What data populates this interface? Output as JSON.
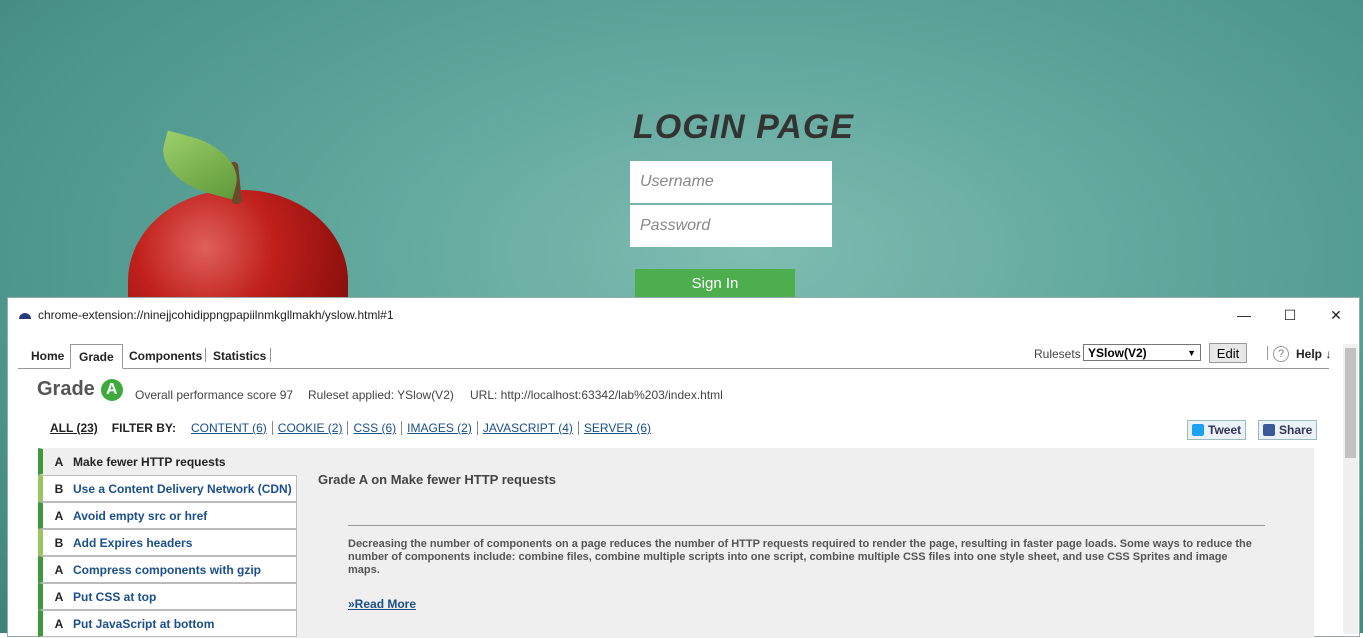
{
  "login": {
    "title": "LOGIN PAGE",
    "username_placeholder": "Username",
    "password_placeholder": "Password",
    "signin_label": "Sign In"
  },
  "popup": {
    "url": "chrome-extension://ninejjcohidippngpapiilnmkgllmakh/yslow.html#1",
    "tabs": [
      "Home",
      "Grade",
      "Components",
      "Statistics"
    ],
    "active_tab": "Grade",
    "rulesets_label": "Rulesets",
    "ruleset_value": "YSlow(V2)",
    "edit_label": "Edit",
    "help_icon_text": "?",
    "help_label": "Help ↓"
  },
  "grade": {
    "label": "Grade",
    "letter": "A",
    "score_text": "Overall performance score 97",
    "ruleset_text": "Ruleset applied: YSlow(V2)",
    "url_text": "URL: http://localhost:63342/lab%203/index.html"
  },
  "filters": {
    "all": "ALL (23)",
    "filter_by": "FILTER BY:",
    "items": [
      "CONTENT (6)",
      "COOKIE (2)",
      "CSS (6)",
      "IMAGES (2)",
      "JAVASCRIPT (4)",
      "SERVER (6)"
    ]
  },
  "social": {
    "tweet": "Tweet",
    "share": "Share"
  },
  "rules": [
    {
      "grade": "A",
      "label": "Make fewer HTTP requests"
    },
    {
      "grade": "B",
      "label": "Use a Content Delivery Network (CDN)"
    },
    {
      "grade": "A",
      "label": "Avoid empty src or href"
    },
    {
      "grade": "B",
      "label": "Add Expires headers"
    },
    {
      "grade": "A",
      "label": "Compress components with gzip"
    },
    {
      "grade": "A",
      "label": "Put CSS at top"
    },
    {
      "grade": "A",
      "label": "Put JavaScript at bottom"
    }
  ],
  "detail": {
    "title": "Grade A on Make fewer HTTP requests",
    "text": "Decreasing the number of components on a page reduces the number of HTTP requests required to render the page, resulting in faster page loads. Some ways to reduce the number of components include: combine files, combine multiple scripts into one script, combine multiple CSS files into one style sheet, and use CSS Sprites and image maps.",
    "read_more": "»Read More"
  },
  "colors": {
    "grade_a": "#3c9a3c",
    "grade_b": "#9ac45c",
    "link": "#1a4f8a",
    "signin": "#4cae4c"
  }
}
